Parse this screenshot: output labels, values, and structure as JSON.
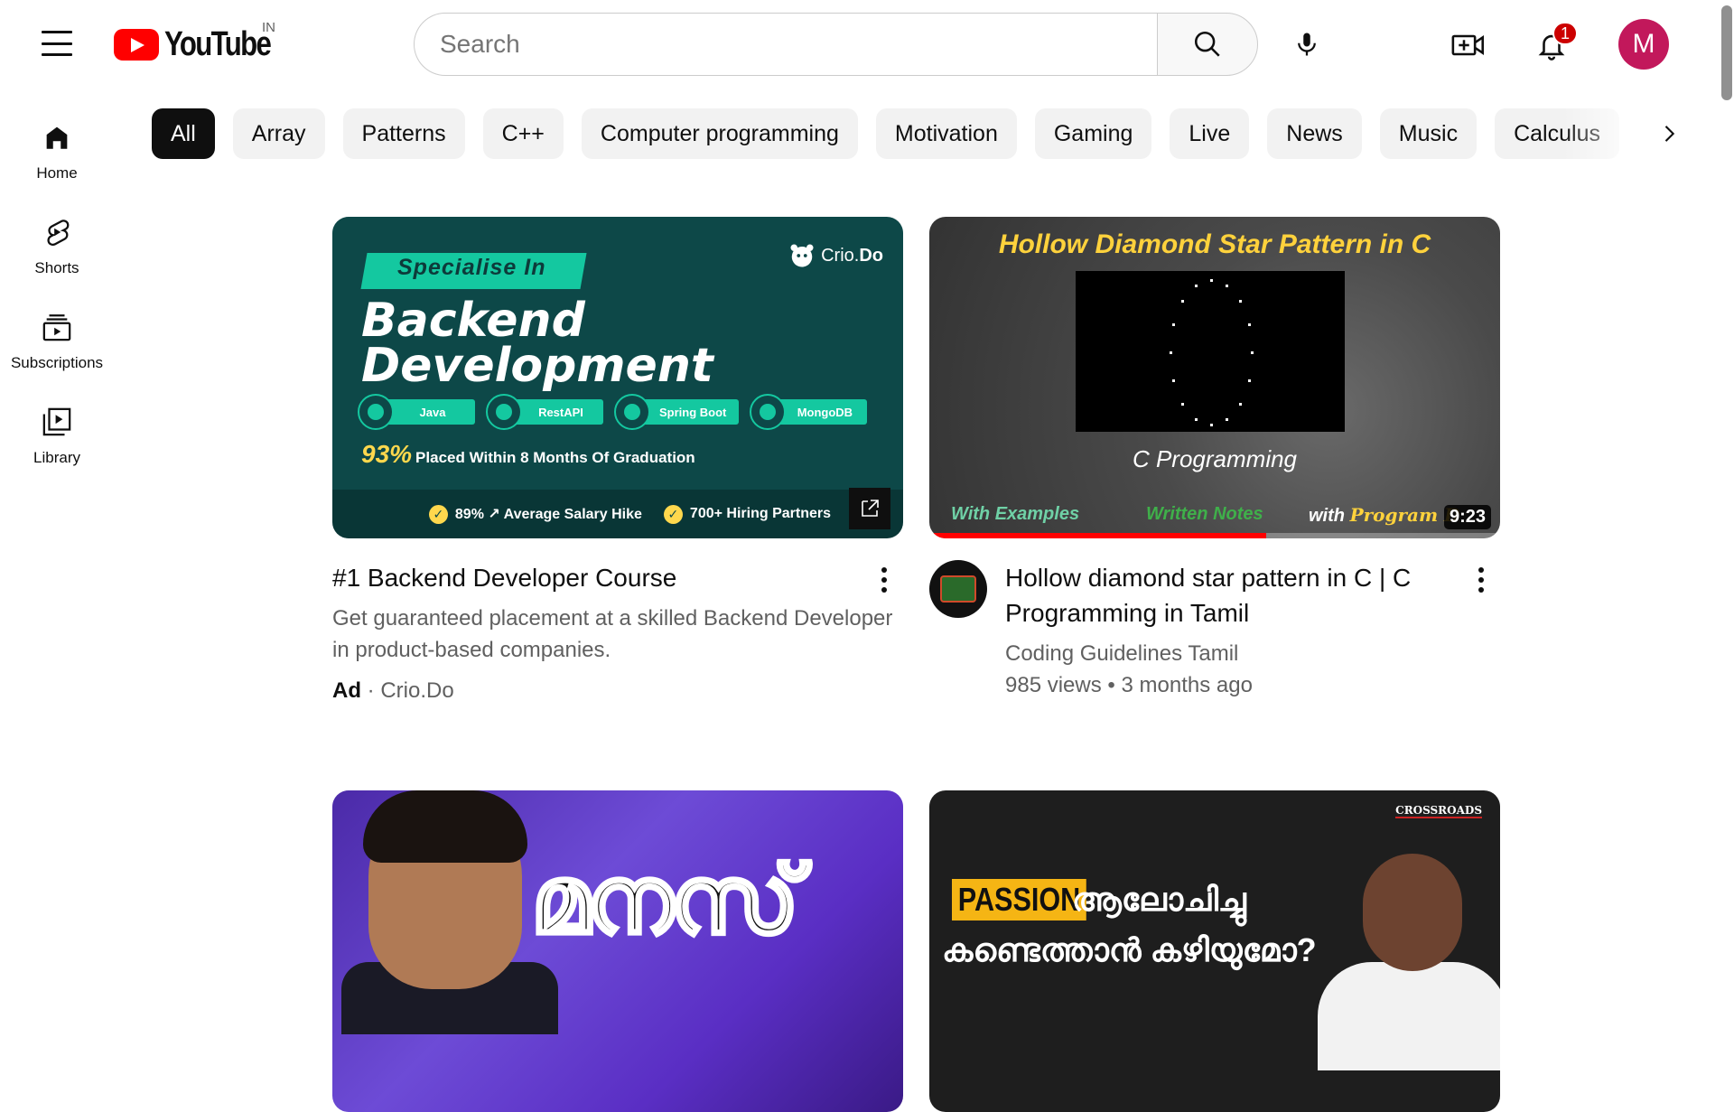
{
  "header": {
    "logo_text": "YouTube",
    "country": "IN",
    "search_placeholder": "Search",
    "notification_count": "1",
    "avatar_letter": "M",
    "avatar_color": "#c2185b"
  },
  "sidebar": {
    "items": [
      {
        "label": "Home",
        "icon": "home-icon"
      },
      {
        "label": "Shorts",
        "icon": "shorts-icon"
      },
      {
        "label": "Subscriptions",
        "icon": "subscriptions-icon"
      },
      {
        "label": "Library",
        "icon": "library-icon"
      }
    ]
  },
  "chips": [
    "All",
    "Array",
    "Patterns",
    "C++",
    "Computer programming",
    "Motivation",
    "Gaming",
    "Live",
    "News",
    "Music",
    "Calculus"
  ],
  "videos": [
    {
      "title": "#1 Backend Developer Course",
      "description": "Get guaranteed placement at a skilled Backend Developer in product-based companies.",
      "ad_label": "Ad",
      "advertiser": "Crio.Do",
      "thumb": {
        "tag": "Specialise In",
        "brand_prefix": "Crio.",
        "brand_suffix": "Do",
        "headline_1": "Backend",
        "headline_2": "Development",
        "pills": [
          "Java",
          "RestAPI",
          "Spring Boot",
          "MongoDB"
        ],
        "stat_value": "93%",
        "stat_text": "Placed Within 8 Months Of Graduation",
        "bottom_1": "89% ↗ Average Salary Hike",
        "bottom_2": "700+ Hiring Partners"
      }
    },
    {
      "title": "Hollow diamond star pattern in C | C Programming in Tamil",
      "channel": "Coding Guidelines Tamil",
      "views": "985 views",
      "age": "3 months ago",
      "duration": "9:23",
      "progress": 0.59,
      "thumb": {
        "title": "Hollow  Diamond Star Pattern in C",
        "subtitle": "C Programming",
        "foot_1": "With Examples",
        "foot_2": "Written Notes",
        "foot_3_prefix": "with",
        "foot_3_brand": "Program D"
      }
    },
    {
      "thumb": {
        "text": "മനസ്"
      }
    },
    {
      "thumb": {
        "logo": "CROSSROADS",
        "tag": "PASSION",
        "line_1": "ആലോചിച്ചു",
        "line_2": "കണ്ടെത്താൻ കഴിയുമോ?"
      }
    }
  ],
  "meta_separator": "·",
  "meta_dot": "•"
}
